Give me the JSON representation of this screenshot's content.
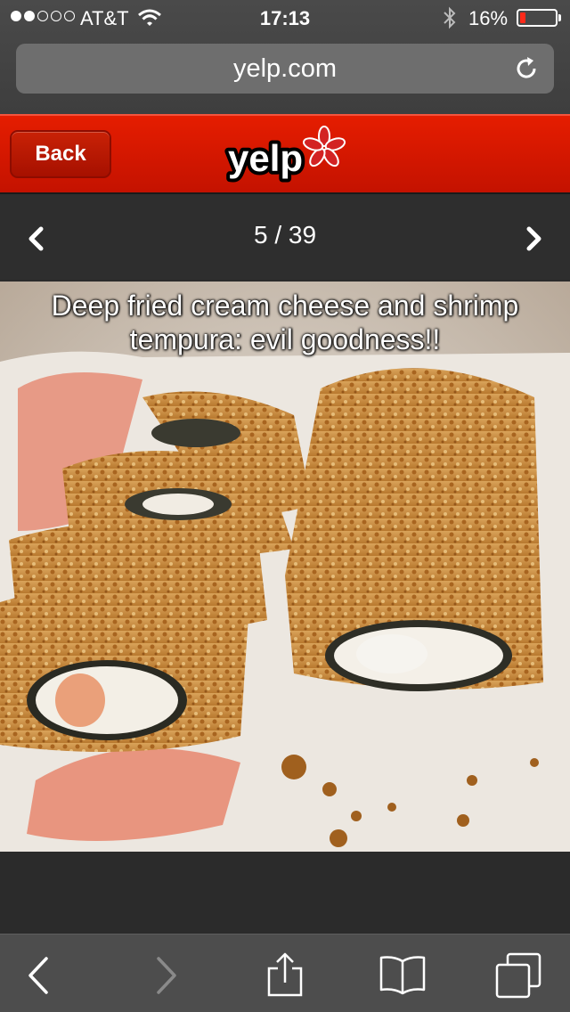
{
  "status_bar": {
    "carrier": "AT&T",
    "time": "17:13",
    "battery_percent": "16%",
    "battery_level": 0.16,
    "signal_bars_filled": 2,
    "signal_bars_total": 5
  },
  "browser": {
    "url": "yelp.com"
  },
  "header": {
    "back_label": "Back",
    "logo_text": "yelp",
    "brand_color": "#d32323"
  },
  "pager": {
    "count_text": "5 / 39",
    "current": 5,
    "total": 39
  },
  "photo": {
    "caption": "Deep fried cream cheese and shrimp tempura: evil goodness!!"
  },
  "toolbar": {
    "items": [
      "back-icon",
      "forward-icon",
      "share-icon",
      "bookmarks-icon",
      "tabs-icon"
    ]
  }
}
